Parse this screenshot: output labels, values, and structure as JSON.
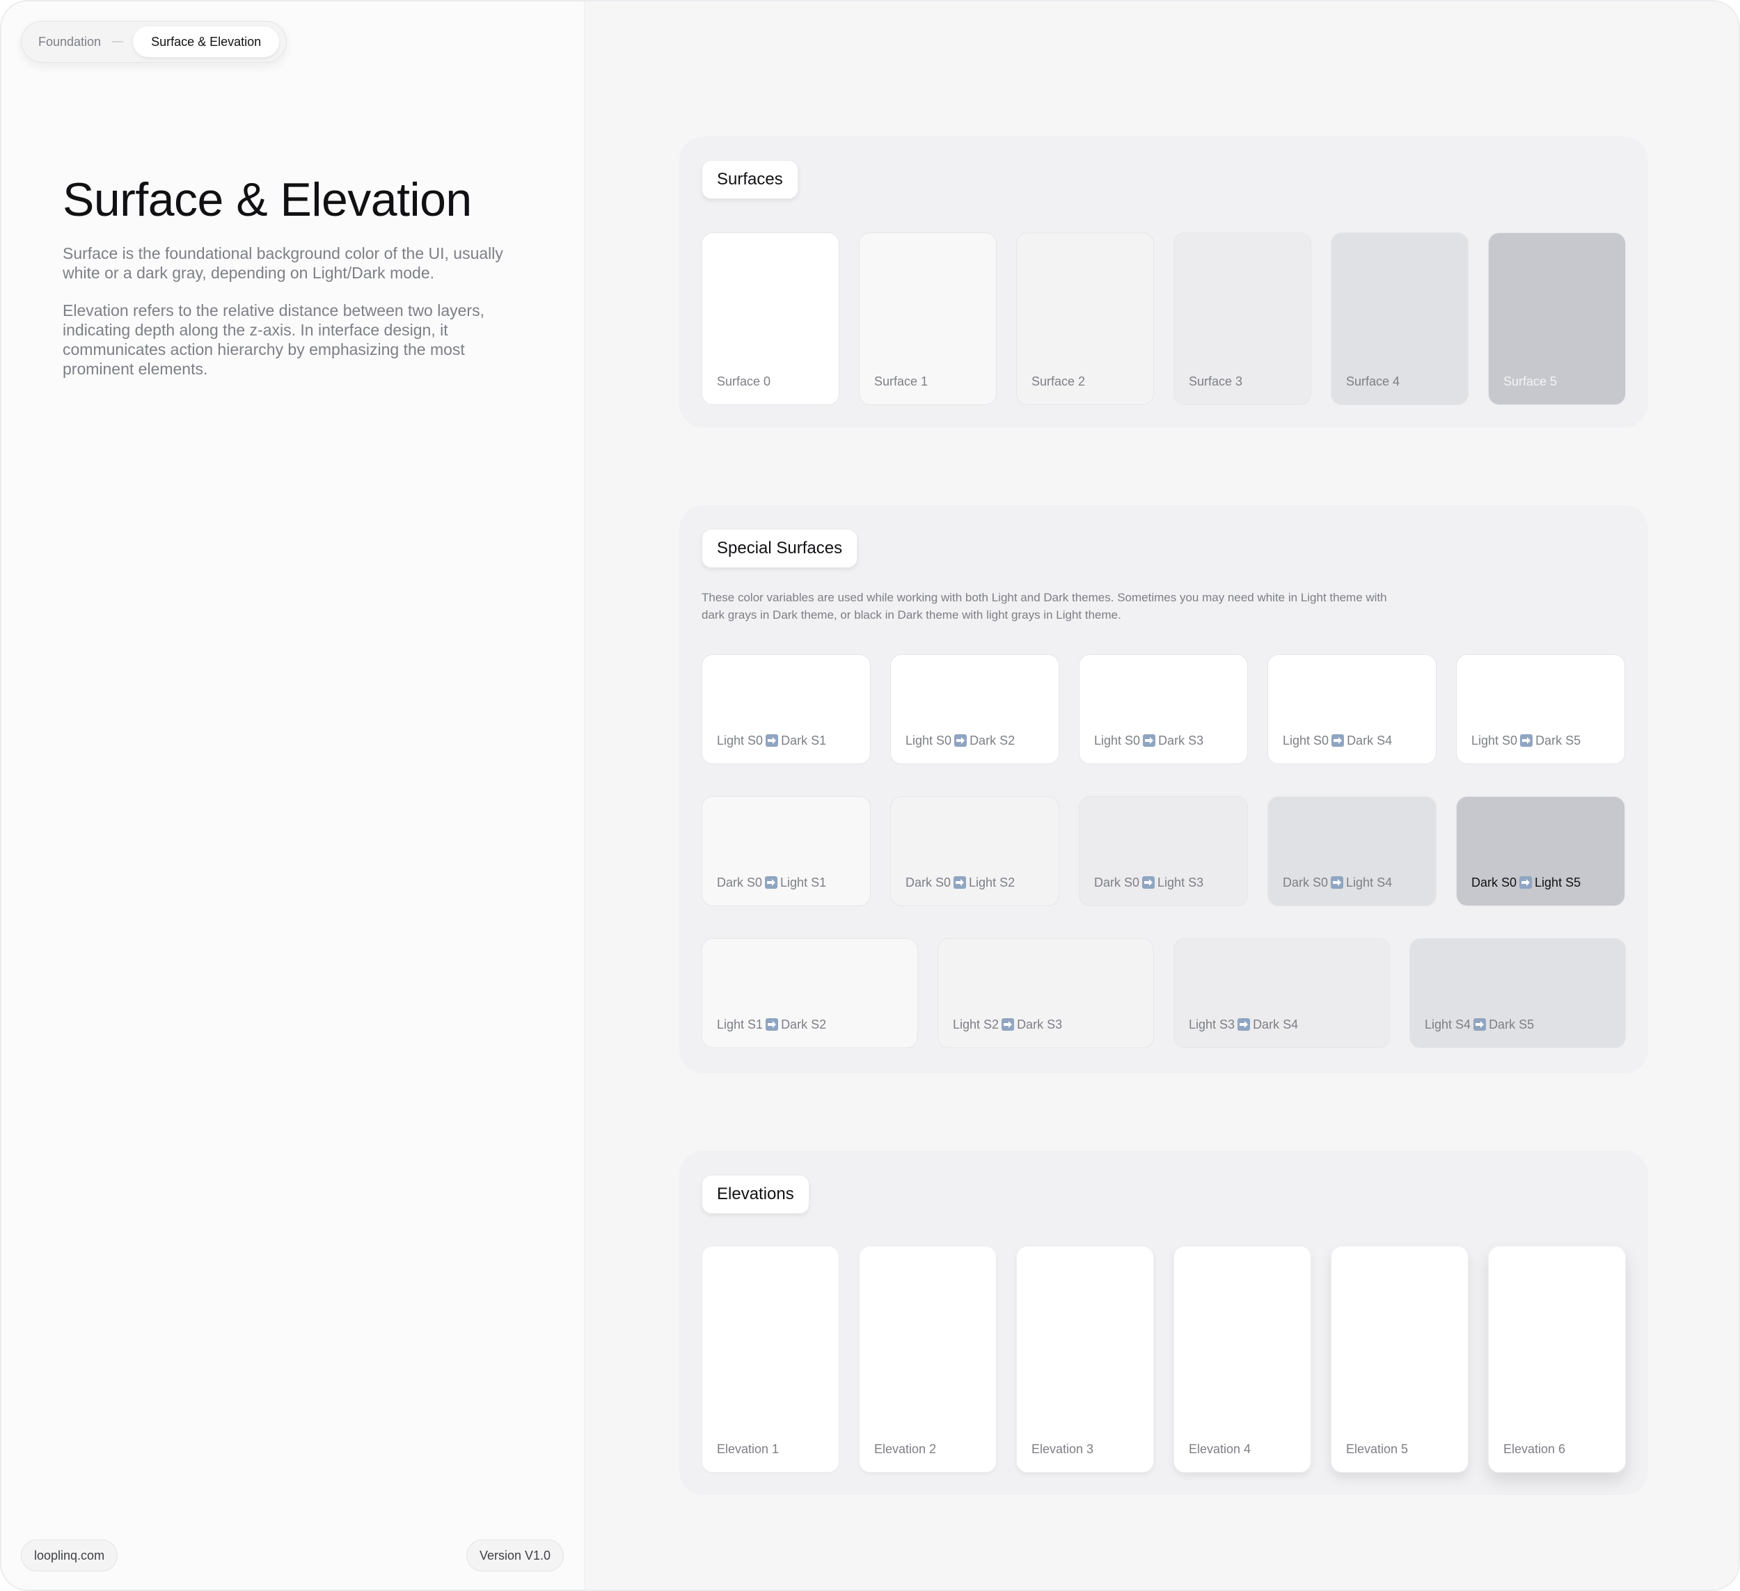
{
  "breadcrumb": {
    "root": "Foundation",
    "current": "Surface & Elevation"
  },
  "page": {
    "title": "Surface & Elevation",
    "description_1": "Surface is the foundational background color of the UI, usually white or a dark gray, depending on Light/Dark mode.",
    "description_2": "Elevation refers to the relative distance between two layers, indicating depth along the z-axis. In interface design, it communicates action hierarchy by emphasizing the most prominent elements."
  },
  "footer": {
    "site": "looplinq.com",
    "version": "Version V1.0"
  },
  "colors": {
    "surface_0": "#ffffff",
    "surface_1": "#f8f8f8",
    "surface_2": "#f3f3f4",
    "surface_3": "#ececee",
    "surface_4": "#e0e1e4",
    "surface_5": "#c6c8cd",
    "arrow_icon": "#8fa5c1"
  },
  "surfaces": {
    "title": "Surfaces",
    "items": [
      "Surface 0",
      "Surface 1",
      "Surface 2",
      "Surface 3",
      "Surface 4",
      "Surface 5"
    ]
  },
  "special": {
    "title": "Special Surfaces",
    "note": "These color variables are used while working with both Light and Dark themes. Sometimes you may need white in Light theme with dark grays in Dark theme, or black in Dark theme with light grays in Light theme.",
    "row1": [
      {
        "a": "Light S0",
        "b": "Dark S1"
      },
      {
        "a": "Light S0",
        "b": "Dark S2"
      },
      {
        "a": "Light S0",
        "b": "Dark S3"
      },
      {
        "a": "Light S0",
        "b": "Dark S4"
      },
      {
        "a": "Light S0",
        "b": "Dark S5"
      }
    ],
    "row2": [
      {
        "a": "Dark S0",
        "b": "Light S1"
      },
      {
        "a": "Dark S0",
        "b": "Light S2"
      },
      {
        "a": "Dark S0",
        "b": "Light S3"
      },
      {
        "a": "Dark S0",
        "b": "Light S4"
      },
      {
        "a": "Dark S0",
        "b": "Light S5"
      }
    ],
    "row3": [
      {
        "a": "Light S1",
        "b": "Dark S2"
      },
      {
        "a": "Light S2",
        "b": "Dark S3"
      },
      {
        "a": "Light S3",
        "b": "Dark S4"
      },
      {
        "a": "Light S4",
        "b": "Dark S5"
      }
    ]
  },
  "elevations": {
    "title": "Elevations",
    "items": [
      "Elevation 1",
      "Elevation 2",
      "Elevation 3",
      "Elevation 4",
      "Elevation 5",
      "Elevation 6"
    ]
  }
}
